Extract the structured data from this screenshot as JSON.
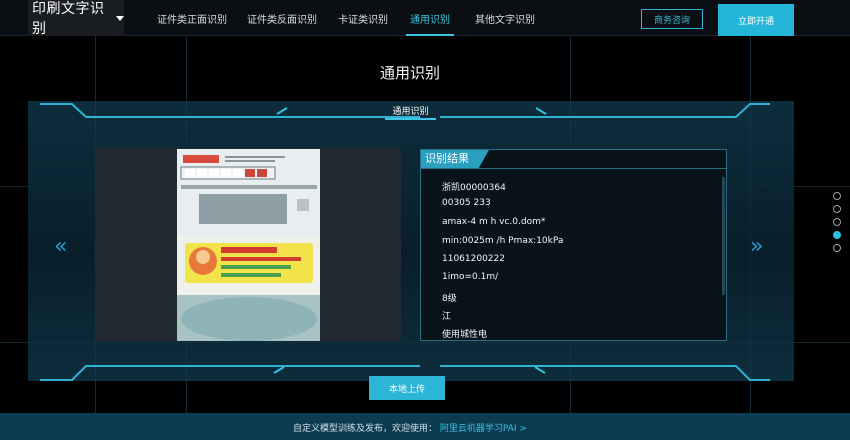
{
  "brand": {
    "title": "印刷文字识别"
  },
  "nav": {
    "items": [
      "证件类正面识别",
      "证件类反面识别",
      "卡证类识别",
      "通用识别",
      "其他文字识别"
    ],
    "active_index": 3,
    "consult_label": "商务咨询",
    "open_label": "立即开通"
  },
  "page": {
    "title": "通用识别"
  },
  "tab": {
    "label": "通用识别"
  },
  "result": {
    "header": "识别结果",
    "items": [
      "浙凯00000364",
      "00305 233",
      "amax-4 m h vc.0.dom*",
      "min:0025m /h Pmax:10kPa",
      "11061200222",
      "1imo=0.1m/",
      "8级",
      "江",
      "使用城性电"
    ]
  },
  "upload": {
    "label": "本地上传"
  },
  "carousel": {
    "count": 5,
    "active": 3
  },
  "footer": {
    "text": "自定义模型训练及发布，欢迎使用：",
    "link": "阿里云机器学习PAI >"
  },
  "colors": {
    "accent": "#2bb5d6",
    "footer_bg": "#0d3c51",
    "page_bg": "#000000"
  },
  "icons": {
    "prev": "double-chevron-left-icon",
    "next": "double-chevron-right-icon",
    "dropdown": "caret-down-icon"
  }
}
